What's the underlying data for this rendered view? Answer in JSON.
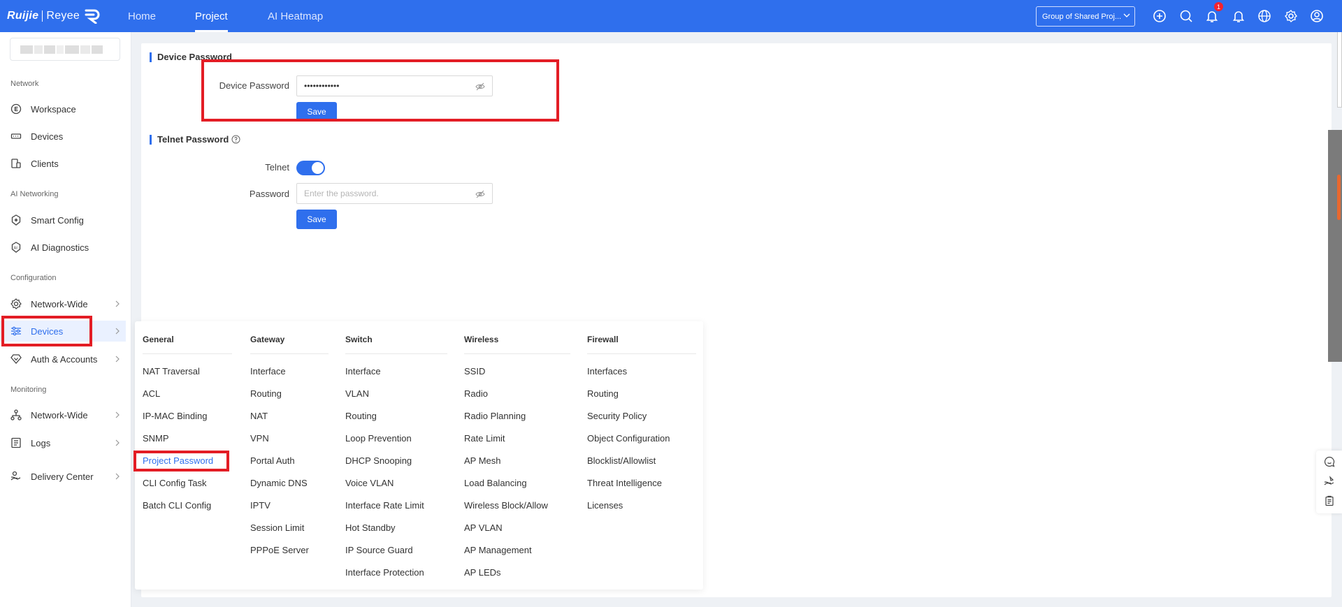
{
  "brand": {
    "name_part1": "Ruijie",
    "name_part2": "Reyee"
  },
  "topnav": {
    "home": "Home",
    "project": "Project",
    "heatmap": "AI Heatmap"
  },
  "group_select": {
    "value": "Group of Shared Proj..."
  },
  "notifications": {
    "count": "1"
  },
  "sidebar": {
    "sections": {
      "network": "Network",
      "ai_networking": "AI Networking",
      "configuration": "Configuration",
      "monitoring": "Monitoring"
    },
    "items": {
      "workspace": "Workspace",
      "devices": "Devices",
      "clients": "Clients",
      "smart_config": "Smart Config",
      "ai_diagnostics": "AI Diagnostics",
      "network_wide_config": "Network-Wide",
      "devices_config": "Devices",
      "auth_accounts": "Auth & Accounts",
      "network_wide_monitor": "Network-Wide",
      "logs": "Logs",
      "delivery_center": "Delivery Center"
    }
  },
  "device_password": {
    "title": "Device Password",
    "label": "Device Password",
    "value": "••••••••••••",
    "save": "Save"
  },
  "telnet_password": {
    "title": "Telnet Password",
    "telnet_label": "Telnet",
    "telnet_enabled": true,
    "password_label": "Password",
    "password_placeholder": "Enter the password.",
    "save": "Save"
  },
  "menu": {
    "general": {
      "title": "General",
      "items": [
        "NAT Traversal",
        "ACL",
        "IP-MAC Binding",
        "SNMP",
        "Project Password",
        "CLI Config Task",
        "Batch CLI Config"
      ]
    },
    "gateway": {
      "title": "Gateway",
      "items": [
        "Interface",
        "Routing",
        "NAT",
        "VPN",
        "Portal Auth",
        "Dynamic DNS",
        "IPTV",
        "Session Limit",
        "PPPoE Server"
      ]
    },
    "switch": {
      "title": "Switch",
      "items": [
        "Interface",
        "VLAN",
        "Routing",
        "Loop Prevention",
        "DHCP Snooping",
        "Voice VLAN",
        "Interface Rate Limit",
        "Hot Standby",
        "IP Source Guard",
        "Interface Protection"
      ]
    },
    "wireless": {
      "title": "Wireless",
      "items": [
        "SSID",
        "Radio",
        "Radio Planning",
        "Rate Limit",
        "AP Mesh",
        "Load Balancing",
        "Wireless Block/Allow",
        "AP VLAN",
        "AP Management",
        "AP LEDs"
      ]
    },
    "firewall": {
      "title": "Firewall",
      "items": [
        "Interfaces",
        "Routing",
        "Security Policy",
        "Object Configuration",
        "Blocklist/Allowlist",
        "Threat Intelligence",
        "Licenses"
      ]
    }
  },
  "colors": {
    "primary": "#2f6fed",
    "highlight": "#e31d25"
  }
}
